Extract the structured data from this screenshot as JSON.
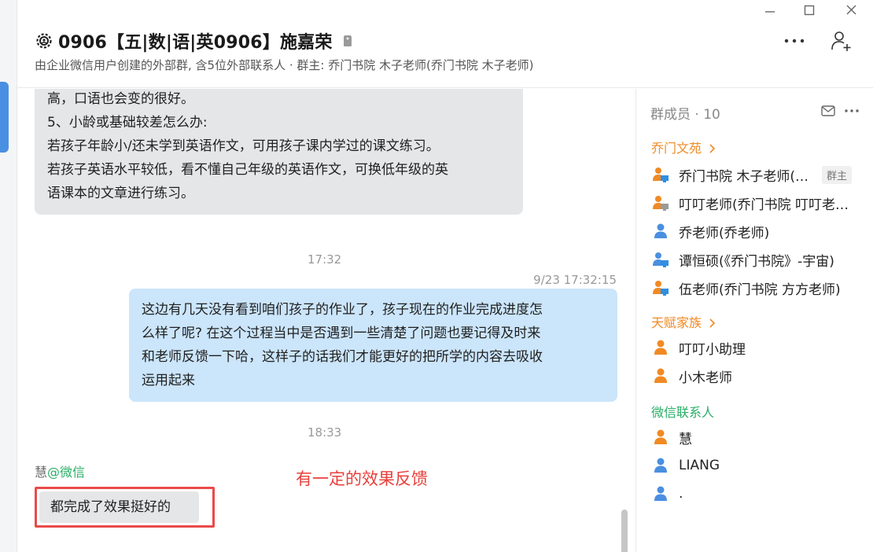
{
  "window": {
    "minimize": "—",
    "maximize": "□",
    "close": "×"
  },
  "header": {
    "title": "0906【五|数|语|英0906】施嘉荣",
    "subtitle": "由企业微信用户创建的外部群, 含5位外部联系人 · 群主: 乔门书院 木子老师(乔门书院 木子老师)"
  },
  "colors": {
    "accent_blue": "#4a90e2",
    "bubble_gray": "#e5e6e8",
    "bubble_blue": "#cbe5fb",
    "orange": "#f08a24",
    "green": "#2aae67",
    "red": "#e8403b"
  },
  "chat": {
    "messages": [
      {
        "lines": [
          "高，口语也会变的很好。",
          "5、小龄或基础较差怎么办:",
          "若孩子年龄小/还未学到英语作文，可用孩子课内学过的课文练习。",
          "若孩子英语水平较低，看不懂自己年级的英语作文，可换低年级的英",
          "语课本的文章进行练习。"
        ]
      },
      {
        "timestamp": "9/23 17:32:15",
        "lines": [
          "这边有几天没有看到咱们孩子的作业了，孩子现在的作业完成进度怎",
          "么样了呢? 在这个过程当中是否遇到一些清楚了问题也要记得及时来",
          "和老师反馈一下哈，这样子的话我们才能更好的把所学的内容去吸收",
          "运用起来"
        ]
      },
      {
        "sender_name": "慧",
        "sender_source": "@微信",
        "text": "都完成了效果挺好的"
      }
    ],
    "time_dividers": [
      "17:32",
      "18:33"
    ],
    "annotation": "有一定的效果反馈"
  },
  "panel": {
    "title": "群成员 · 10",
    "sections": [
      {
        "title": "乔门文苑",
        "members": [
          {
            "name": "乔门书院 木子老师(乔门书院 木子老师)",
            "badge": "群主",
            "icon": "person-computer-icon"
          },
          {
            "name": "叮叮老师(乔门书院 叮叮老师)",
            "icon": "person-computer-gray-icon"
          },
          {
            "name": "乔老师(乔老师)",
            "icon": "person-icon"
          },
          {
            "name": "谭恒硕(《乔门书院》-宇宙)",
            "icon": "person-computer-icon"
          },
          {
            "name": "伍老师(乔门书院 方方老师)",
            "icon": "person-computer-icon"
          }
        ]
      },
      {
        "title": "天赋家族",
        "members": [
          {
            "name": "叮叮小助理",
            "icon": "person-icon"
          },
          {
            "name": "小木老师",
            "icon": "person-icon"
          }
        ]
      },
      {
        "title": "微信联系人",
        "members": [
          {
            "name": "慧",
            "icon": "person-icon"
          },
          {
            "name": "LIANG",
            "icon": "person-icon"
          },
          {
            "name": ".",
            "icon": "person-icon"
          }
        ]
      }
    ]
  }
}
